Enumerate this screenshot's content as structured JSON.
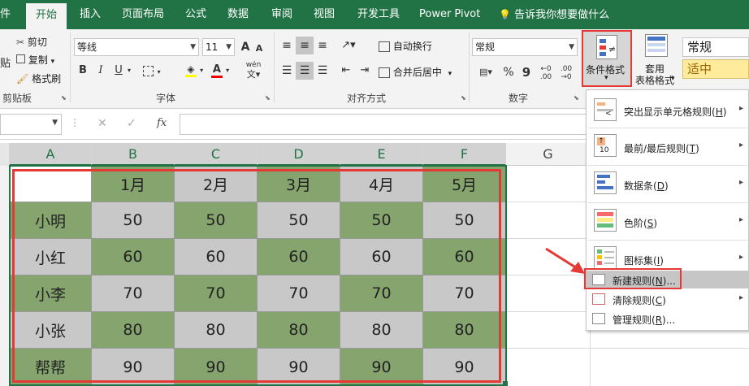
{
  "tabs": [
    {
      "label": "件"
    },
    {
      "label": "开始",
      "active": true
    },
    {
      "label": "插入"
    },
    {
      "label": "页面布局"
    },
    {
      "label": "公式"
    },
    {
      "label": "数据"
    },
    {
      "label": "审阅"
    },
    {
      "label": "视图"
    },
    {
      "label": "开发工具"
    },
    {
      "label": "Power Pivot"
    }
  ],
  "tell_me": "告诉我你想要做什么",
  "clipboard": {
    "cut": "剪切",
    "copy": "复制",
    "copy_arrow": "▾",
    "format_painter": "格式刷",
    "paste_fragment": "贴",
    "label": "剪贴板"
  },
  "font": {
    "name": "等线",
    "size": "11",
    "bold": "B",
    "italic": "I",
    "underline": "U",
    "underline_arrow": "▾",
    "increase": "A",
    "decrease": "A",
    "phonetic": "wén",
    "label": "字体"
  },
  "alignment": {
    "wrap": "自动换行",
    "merge": "合并后居中",
    "merge_arrow": "▾",
    "label": "对齐方式"
  },
  "number": {
    "format": "常规",
    "percent": "%",
    "comma": "9",
    "label": "数字"
  },
  "styles": {
    "conditional": "条件格式",
    "conditional_arrow": "▾",
    "table_line1": "套用",
    "table_line2": "表格格式",
    "table_arrow": "▾",
    "style_normal": "常规",
    "style_neutral": "适中"
  },
  "formula_bar": {
    "fx": "fx",
    "cancel": "✕",
    "confirm": "✓"
  },
  "columns": [
    "A",
    "B",
    "C",
    "D",
    "E",
    "F",
    "G"
  ],
  "table": {
    "header": [
      "",
      "1月",
      "2月",
      "3月",
      "4月",
      "5月"
    ],
    "rows": [
      {
        "name": "小明",
        "values": [
          "50",
          "50",
          "50",
          "50",
          "50"
        ]
      },
      {
        "name": "小红",
        "values": [
          "60",
          "60",
          "60",
          "60",
          "60"
        ]
      },
      {
        "name": "小李",
        "values": [
          "70",
          "70",
          "70",
          "70",
          "70"
        ]
      },
      {
        "name": "小张",
        "values": [
          "80",
          "80",
          "80",
          "80",
          "80"
        ]
      },
      {
        "name": "帮帮",
        "values": [
          "90",
          "90",
          "90",
          "90",
          "90"
        ]
      }
    ]
  },
  "menu": {
    "items": [
      {
        "label": "突出显示单元格规则(",
        "key": "H",
        "tail": ")"
      },
      {
        "label": "最前/最后规则(",
        "key": "T",
        "tail": ")"
      },
      {
        "label": "数据条(",
        "key": "D",
        "tail": ")"
      },
      {
        "label": "色阶(",
        "key": "S",
        "tail": ")"
      },
      {
        "label": "图标集(",
        "key": "I",
        "tail": ")"
      }
    ],
    "new_rule": {
      "label": "新建规则(",
      "key": "N",
      "tail": ")..."
    },
    "clear_rules": {
      "label": "清除规则(",
      "key": "C",
      "tail": ")"
    },
    "manage_rules": {
      "label": "管理规则(",
      "key": "R",
      "tail": ")..."
    },
    "submenu_arrow": "▸",
    "icon_text_highlight": "<",
    "icon_text_top": "10"
  },
  "colors": {
    "excel_green": "#217346",
    "cell_green": "#85a46e",
    "cell_grey": "#c8c8c8",
    "highlight_red": "#e53935",
    "neutral_style": "#ffeb9c"
  }
}
